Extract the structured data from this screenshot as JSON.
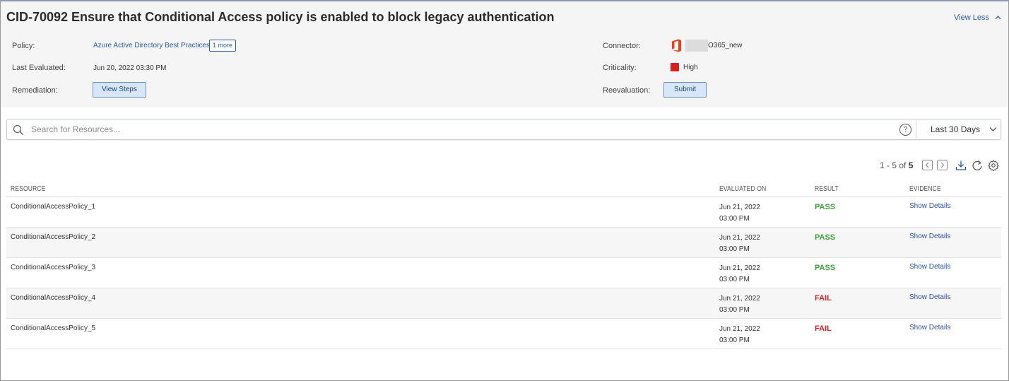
{
  "header": {
    "title": "CID-70092 Ensure that Conditional Access policy is enabled to block legacy authentication",
    "view_less": "View Less",
    "policy_label": "Policy:",
    "policy_value": "Azure Active Directory Best Practices",
    "policy_more": "1 more",
    "last_evaluated_label": "Last Evaluated:",
    "last_evaluated_value": "Jun 20, 2022 03:30 PM",
    "remediation_label": "Remediation:",
    "remediation_button": "View Steps",
    "connector_label": "Connector:",
    "connector_value": "O365_new",
    "criticality_label": "Criticality:",
    "criticality_value": "High",
    "reevaluation_label": "Reevaluation:",
    "reevaluation_button": "Submit"
  },
  "colors": {
    "pass": "#3f9e3f",
    "fail": "#d02323",
    "criticality_high": "#d81e1e",
    "office_icon": "#e8421b",
    "link": "#2b5aa0"
  },
  "search": {
    "placeholder": "Search for Resources...",
    "value": "",
    "help_icon": "?",
    "range": "Last 30 Days"
  },
  "pager": {
    "range": "1 - 5 of",
    "total": "5"
  },
  "table": {
    "columns": [
      "RESOURCE",
      "EVALUATED ON",
      "RESULT",
      "EVIDENCE"
    ],
    "rows": [
      {
        "resource": "ConditionalAccessPolicy_1",
        "date": "Jun 21, 2022",
        "time": "03:00 PM",
        "result": "PASS",
        "evidence": "Show Details"
      },
      {
        "resource": "ConditionalAccessPolicy_2",
        "date": "Jun 21, 2022",
        "time": "03:00 PM",
        "result": "PASS",
        "evidence": "Show Details"
      },
      {
        "resource": "ConditionalAccessPolicy_3",
        "date": "Jun 21, 2022",
        "time": "03:00 PM",
        "result": "PASS",
        "evidence": "Show Details"
      },
      {
        "resource": "ConditionalAccessPolicy_4",
        "date": "Jun 21, 2022",
        "time": "03:00 PM",
        "result": "FAIL",
        "evidence": "Show Details"
      },
      {
        "resource": "ConditionalAccessPolicy_5",
        "date": "Jun 21, 2022",
        "time": "03:00 PM",
        "result": "FAIL",
        "evidence": "Show Details"
      }
    ]
  },
  "icons": {
    "search": "search-icon",
    "help": "help-icon",
    "range_dropdown": "chevron-down-icon",
    "prev_page": "chevron-left-icon",
    "next_page": "chevron-right-icon",
    "download": "download-icon",
    "refresh": "refresh-icon",
    "settings": "gear-icon",
    "view_less": "chevron-up-icon",
    "connector": "office-icon"
  }
}
